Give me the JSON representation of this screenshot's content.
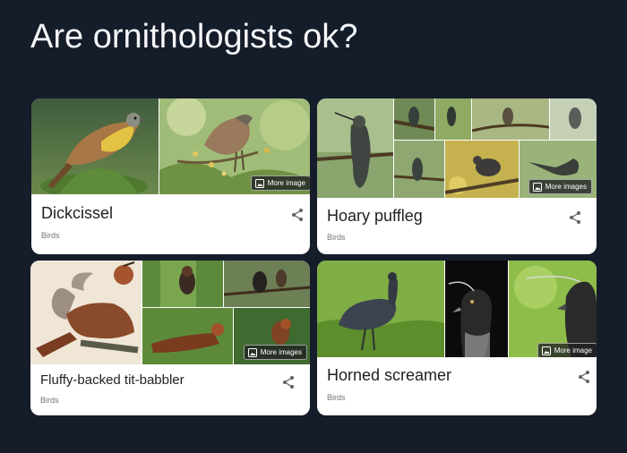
{
  "headline": "Are ornithologists ok?",
  "colors": {
    "page_bg": "#151c2a",
    "card_bg": "#ffffff",
    "title": "#202124",
    "subtitle": "#70757a"
  },
  "cards": [
    {
      "name": "Dickcissel",
      "category": "Birds",
      "more_images": "More image",
      "icon": "share-icon"
    },
    {
      "name": "Hoary puffleg",
      "category": "Birds",
      "more_images": "More images",
      "icon": "share-icon"
    },
    {
      "name": "Fluffy-backed tit-babbler",
      "category": "Birds",
      "more_images": "More images",
      "icon": "share-icon"
    },
    {
      "name": "Horned screamer",
      "category": "Birds",
      "more_images": "More image",
      "icon": "share-icon"
    }
  ]
}
